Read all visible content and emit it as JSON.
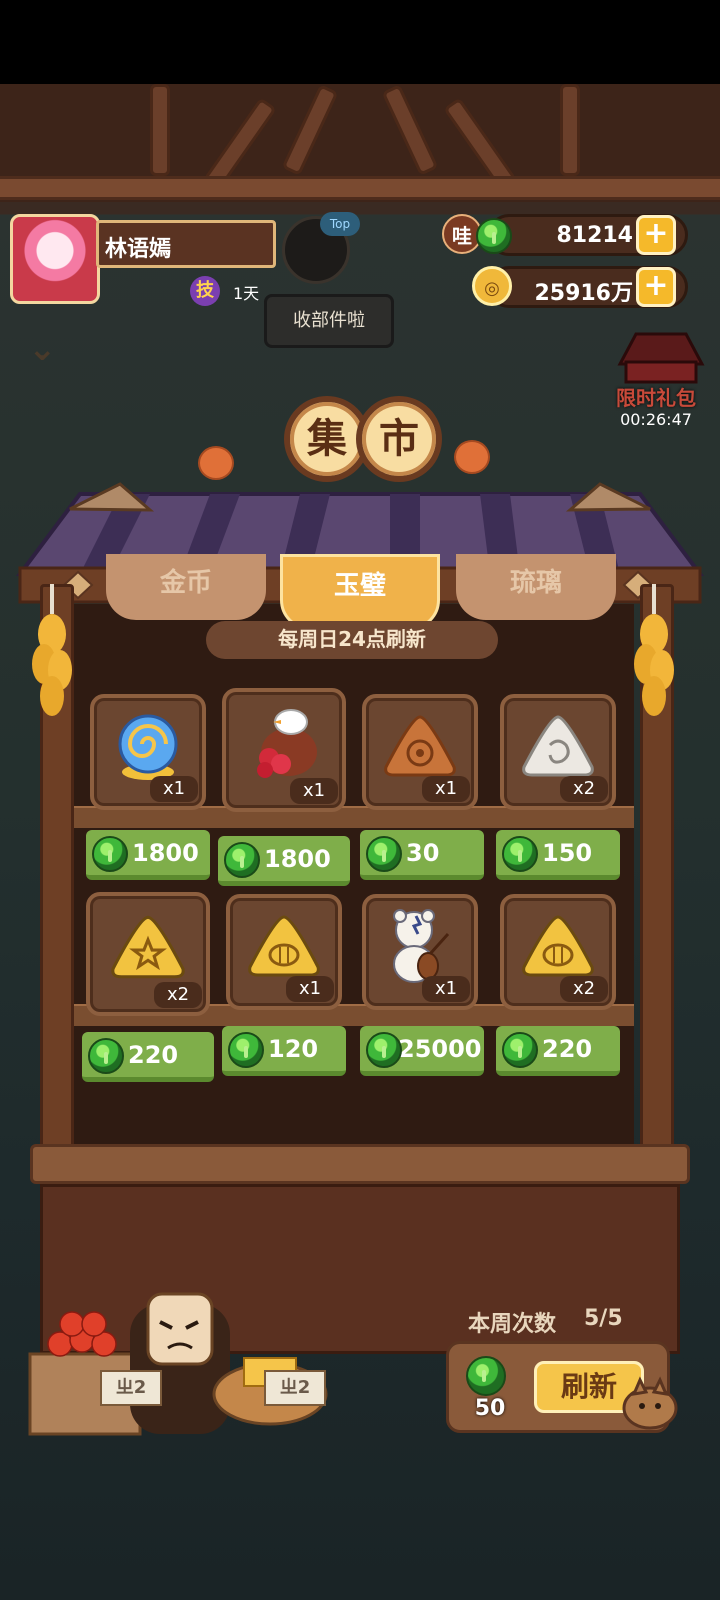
{
  "profile": {
    "name": "林语嫣",
    "skill_badge": "技",
    "days": "1天",
    "top_tag": "Top",
    "mail_bubble": "收部件啦"
  },
  "currency": {
    "jade_badge": "哇",
    "jade_amount": "81214",
    "coin_amount": "25916万",
    "plus": "+"
  },
  "side_gift": {
    "label": "限时礼包",
    "timer": "00:26:47"
  },
  "market": {
    "title_chars": [
      "集",
      "市"
    ],
    "tabs": [
      "金币",
      "玉璧",
      "琉璃"
    ],
    "active_tab": 1,
    "refresh_note": "每周日24点刷新",
    "items": [
      {
        "qty": "x1",
        "price": "1800",
        "icon": "blue-snail-shell-icon"
      },
      {
        "qty": "x1",
        "price": "1800",
        "icon": "bird-flower-pot-icon"
      },
      {
        "qty": "x1",
        "price": "30",
        "icon": "orange-triangle-rune-icon"
      },
      {
        "qty": "x2",
        "price": "150",
        "icon": "white-triangle-rune-icon"
      },
      {
        "qty": "x2",
        "price": "220",
        "icon": "gold-star-triangle-icon"
      },
      {
        "qty": "x1",
        "price": "120",
        "icon": "gold-fish-triangle-icon"
      },
      {
        "qty": "x1",
        "price": "25000",
        "icon": "bear-with-lute-icon"
      },
      {
        "qty": "x2",
        "price": "220",
        "icon": "gold-fish-triangle-icon"
      }
    ],
    "weekly_label": "本周次数",
    "weekly_count": "5/5",
    "refresh_cost": "50",
    "refresh_label": "刷新"
  },
  "vendor": {
    "board_left": "ㄓ2",
    "board_right": "ㄓ2"
  },
  "colors": {
    "price_green": "#7fae4a",
    "tab_active": "#f0b24a",
    "refresh_button": "#f5c54a",
    "wood_dark": "#2f1b12"
  }
}
